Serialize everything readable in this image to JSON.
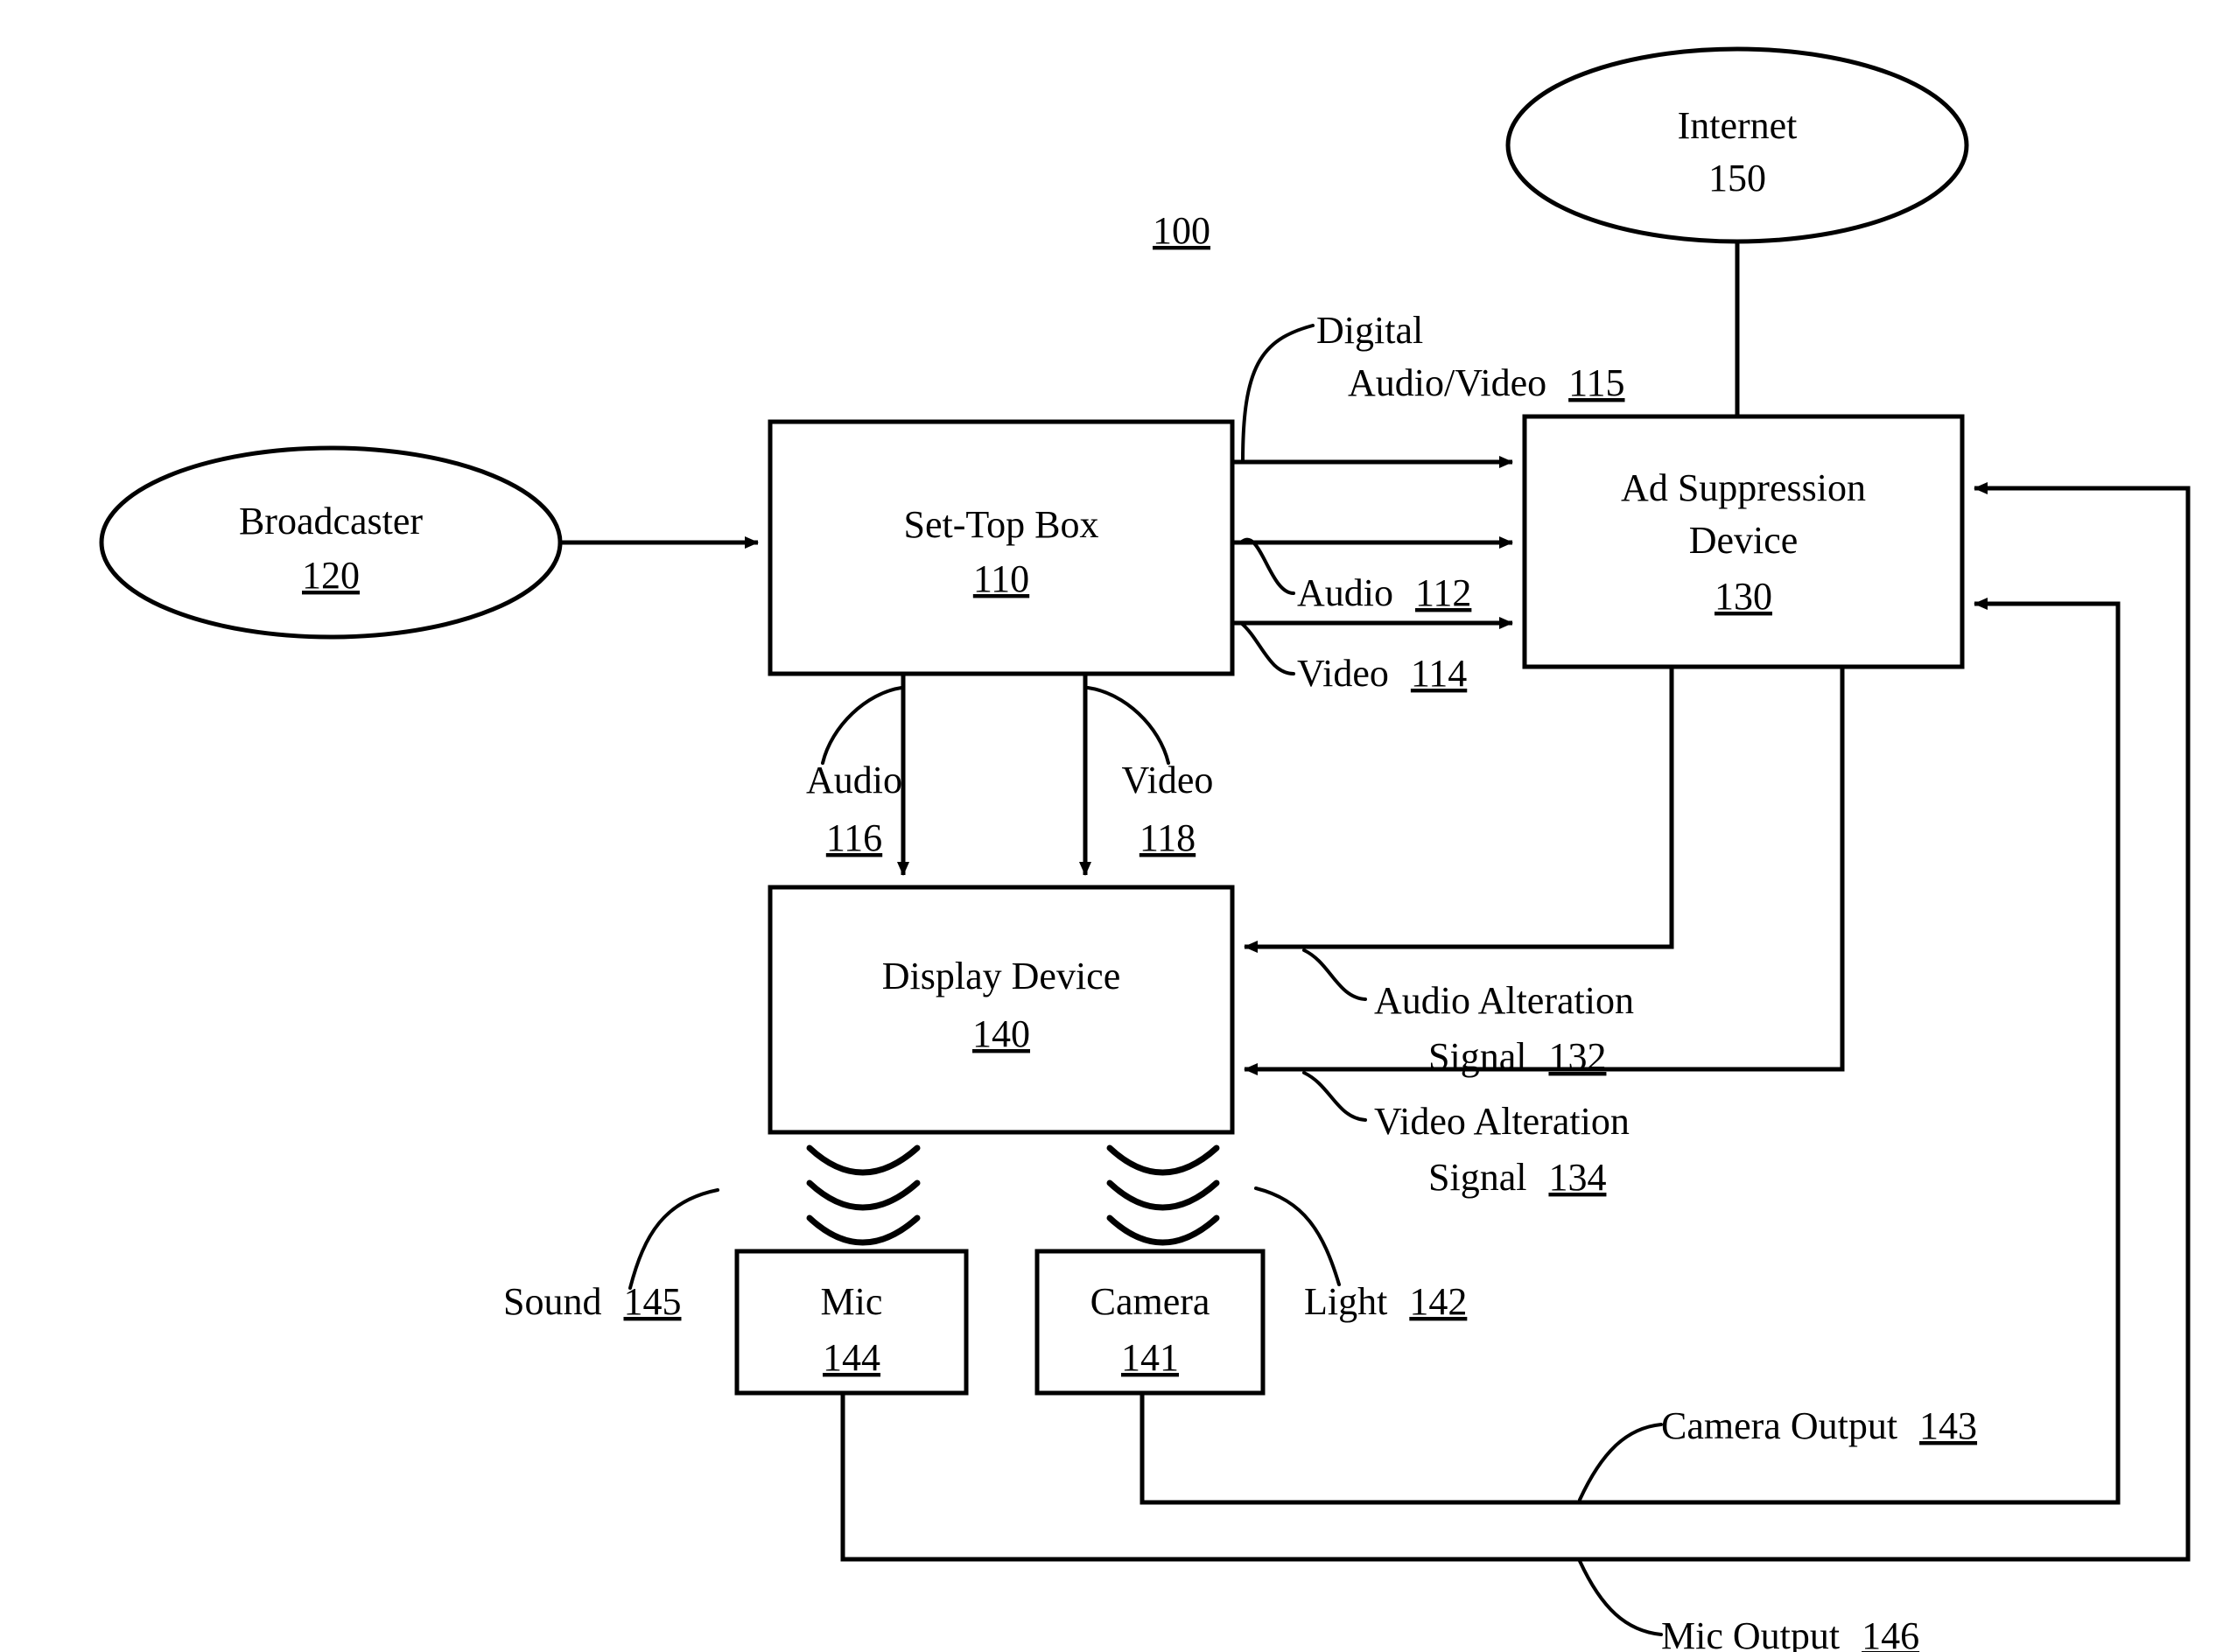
{
  "figure": {
    "number": "100",
    "number_underlined": true
  },
  "nodes": {
    "broadcaster": {
      "title": "Broadcaster",
      "ref": "120",
      "shape": "ellipse"
    },
    "set_top_box": {
      "title": "Set-Top Box",
      "ref": "110",
      "shape": "box"
    },
    "ad_suppression_device": {
      "title_line1": "Ad Suppression",
      "title_line2": "Device",
      "ref": "130",
      "shape": "box"
    },
    "internet": {
      "title": "Internet",
      "ref": "150",
      "shape": "ellipse"
    },
    "display_device": {
      "title": "Display Device",
      "ref": "140",
      "shape": "box"
    },
    "mic": {
      "title": "Mic",
      "ref": "144",
      "shape": "box"
    },
    "camera": {
      "title": "Camera",
      "ref": "141",
      "shape": "box"
    }
  },
  "signals": {
    "digital_av": {
      "line1": "Digital",
      "line2": "Audio/Video",
      "ref": "115"
    },
    "audio_112": {
      "line1": "Audio",
      "ref": "112"
    },
    "video_114": {
      "line1": "Video",
      "ref": "114"
    },
    "audio_116": {
      "line1": "Audio",
      "ref": "116"
    },
    "video_118": {
      "line1": "Video",
      "ref": "118"
    },
    "audio_alteration": {
      "line1": "Audio Alteration",
      "line2": "Signal",
      "ref": "132"
    },
    "video_alteration": {
      "line1": "Video Alteration",
      "line2": "Signal",
      "ref": "134"
    },
    "sound_145": {
      "line1": "Sound",
      "ref": "145"
    },
    "light_142": {
      "line1": "Light",
      "ref": "142"
    },
    "camera_output": {
      "line1": "Camera Output",
      "ref": "143"
    },
    "mic_output": {
      "line1": "Mic Output",
      "ref": "146"
    }
  },
  "colors": {
    "stroke": "#000000",
    "background": "#ffffff",
    "text": "#000000"
  }
}
